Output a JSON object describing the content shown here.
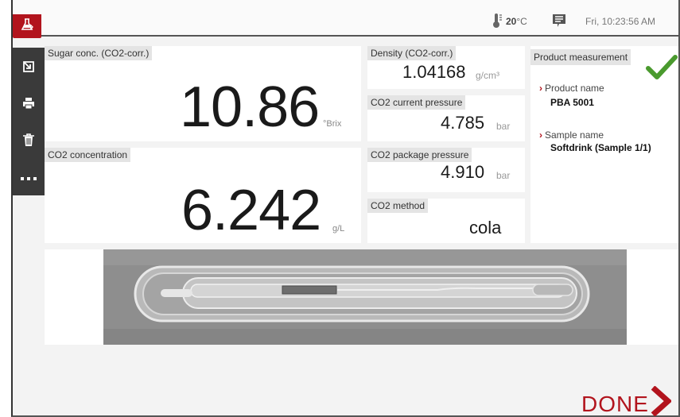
{
  "status": {
    "temperature_value": "20",
    "temperature_unit": "°C",
    "datetime": "Fri, 10:23:56 AM"
  },
  "sidebar": {
    "items": [
      {
        "name": "export"
      },
      {
        "name": "print"
      },
      {
        "name": "delete"
      },
      {
        "name": "more"
      }
    ]
  },
  "sugar": {
    "label": "Sugar conc. (CO2-corr.)",
    "value": "10.86",
    "unit": "°Brix"
  },
  "co2conc": {
    "label": "CO2 concentration",
    "value": "6.242",
    "unit": "g/L"
  },
  "density": {
    "label": "Density (CO2-corr.)",
    "value": "1.04168",
    "unit": "g/cm³"
  },
  "co2current": {
    "label": "CO2 current pressure",
    "value": "4.785",
    "unit": "bar"
  },
  "co2package": {
    "label": "CO2 package pressure",
    "value": "4.910",
    "unit": "bar"
  },
  "co2method": {
    "label": "CO2 method",
    "value": "cola"
  },
  "product": {
    "header": "Product measurement",
    "product_name_label": "Product name",
    "product_name_value": "PBA 5001",
    "sample_name_label": "Sample name",
    "sample_name_value": "Softdrink (Sample 1/1)",
    "status": "ok"
  },
  "footer": {
    "done_label": "DONE"
  },
  "colors": {
    "accent": "#b2141d",
    "ok_green": "#4a9a2e",
    "sidebar": "#3a3a3a"
  }
}
